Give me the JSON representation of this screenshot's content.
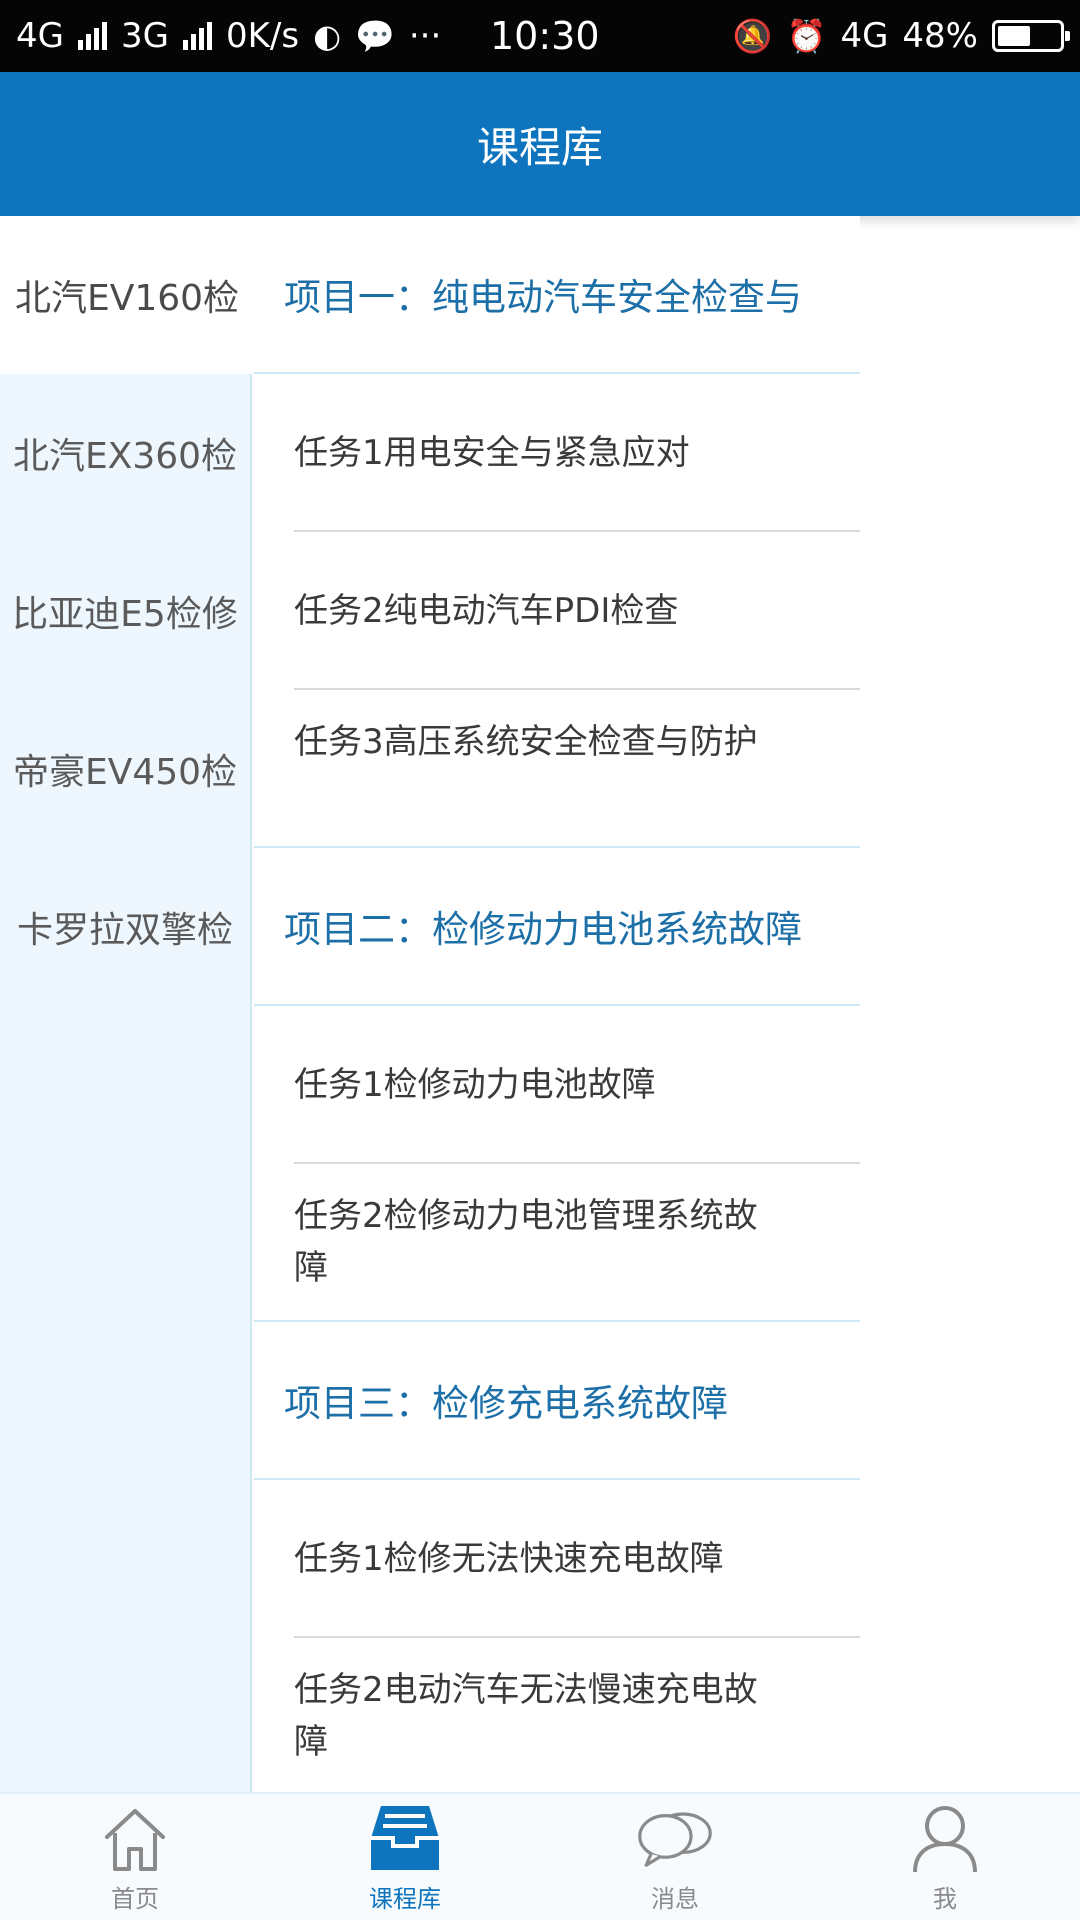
{
  "status_bar": {
    "network1": "4G",
    "network2": "3G",
    "speed": "0K/s",
    "more": "···",
    "time": "10:30",
    "network3": "4G",
    "battery": "48%",
    "battery_level": 0.48
  },
  "header": {
    "title": "课程库"
  },
  "sidebar": {
    "items": [
      {
        "label": "北汽EV160检"
      },
      {
        "label": "北汽EX360检"
      },
      {
        "label": "比亚迪E5检修"
      },
      {
        "label": "帝豪EV450检"
      },
      {
        "label": "卡罗拉双擎检"
      }
    ]
  },
  "content": {
    "sections": [
      {
        "title": "项目一：纯电动汽车安全检查与",
        "tasks": [
          {
            "label": "任务1用电安全与紧急应对"
          },
          {
            "label": "任务2纯电动汽车PDI检查"
          },
          {
            "label": "任务3高压系统安全检查与防护"
          }
        ]
      },
      {
        "title": "项目二：检修动力电池系统故障",
        "tasks": [
          {
            "label": "任务1检修动力电池故障"
          },
          {
            "label": "任务2检修动力电池管理系统故障"
          }
        ]
      },
      {
        "title": "项目三：检修充电系统故障",
        "tasks": [
          {
            "label": "任务1检修无法快速充电故障"
          },
          {
            "label": "任务2电动汽车无法慢速充电故障"
          }
        ]
      }
    ]
  },
  "bottom_nav": {
    "items": [
      {
        "label": "首页",
        "icon": "home-icon"
      },
      {
        "label": "课程库",
        "icon": "inbox-tray-icon"
      },
      {
        "label": "消息",
        "icon": "chat-bubbles-icon"
      },
      {
        "label": "我",
        "icon": "person-icon"
      }
    ]
  },
  "colors": {
    "header": "#0d74bd",
    "sidebar_bg": "#eef7fd",
    "section_text": "#1d6fa8",
    "nav_active": "#0d74bd"
  }
}
